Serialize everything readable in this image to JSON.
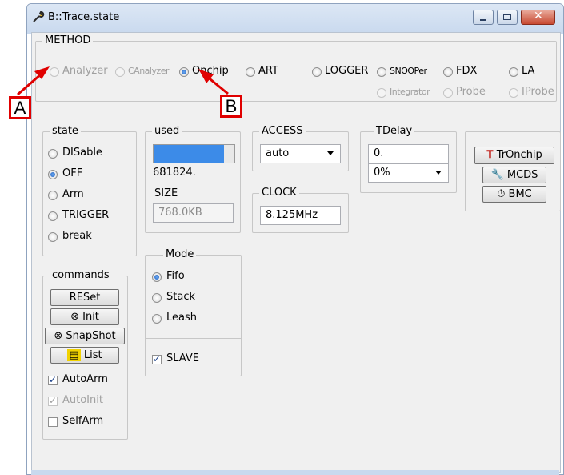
{
  "window": {
    "title": "B::Trace.state"
  },
  "method": {
    "legend": "METHOD",
    "options": [
      "Analyzer",
      "CAnalyzer",
      "Onchip",
      "ART",
      "LOGGER",
      "SNOOPer",
      "FDX",
      "LA",
      "Integrator",
      "Probe",
      "IProbe"
    ],
    "selected": "Onchip"
  },
  "state": {
    "legend": "state",
    "options": [
      "DISable",
      "OFF",
      "Arm",
      "TRIGGER",
      "break"
    ],
    "selected": "OFF"
  },
  "used": {
    "legend": "used",
    "value": "681824.",
    "fill_fraction": 0.87
  },
  "size": {
    "legend": "SIZE",
    "value": "768.0KB"
  },
  "access": {
    "legend": "ACCESS",
    "value": "auto"
  },
  "clock": {
    "legend": "CLOCK",
    "value": "8.125MHz"
  },
  "tdelay": {
    "legend": "TDelay",
    "value": "0.",
    "percent": "0%"
  },
  "tools": {
    "tronchip": "TrOnchip",
    "mcds": "MCDS",
    "bmc": "BMC"
  },
  "commands": {
    "legend": "commands",
    "reset": "RESet",
    "init": "Init",
    "snapshot": "SnapShot",
    "list": "List",
    "autoarm": "AutoArm",
    "autoinit": "AutoInit",
    "selfarm": "SelfArm"
  },
  "mode": {
    "legend": "Mode",
    "options": [
      "Fifo",
      "Stack",
      "Leash"
    ],
    "selected": "Fifo",
    "slave": "SLAVE"
  },
  "callouts": {
    "a": "A",
    "b": "B"
  },
  "colors": {
    "used_bar": "#3c8be8",
    "callout": "#e00000"
  }
}
